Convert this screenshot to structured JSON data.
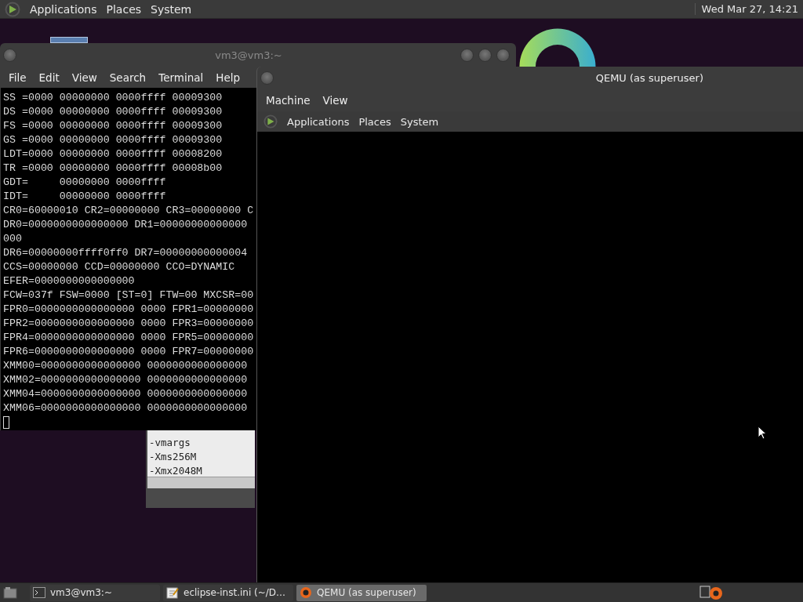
{
  "top_panel": {
    "menus": [
      "Applications",
      "Places",
      "System"
    ],
    "clock": "Wed Mar 27, 14:21"
  },
  "terminal_window": {
    "title": "vm3@vm3:~",
    "menus": [
      "File",
      "Edit",
      "View",
      "Search",
      "Terminal",
      "Help"
    ],
    "lines": [
      "SS =0000 00000000 0000ffff 00009300",
      "DS =0000 00000000 0000ffff 00009300",
      "FS =0000 00000000 0000ffff 00009300",
      "GS =0000 00000000 0000ffff 00009300",
      "LDT=0000 00000000 0000ffff 00008200",
      "TR =0000 00000000 0000ffff 00008b00",
      "GDT=     00000000 0000ffff",
      "IDT=     00000000 0000ffff",
      "CR0=60000010 CR2=00000000 CR3=00000000 C",
      "DR0=0000000000000000 DR1=00000000000000",
      "000",
      "DR6=00000000ffff0ff0 DR7=00000000000004",
      "CCS=00000000 CCD=00000000 CCO=DYNAMIC",
      "EFER=0000000000000000",
      "FCW=037f FSW=0000 [ST=0] FTW=00 MXCSR=00",
      "FPR0=0000000000000000 0000 FPR1=00000000",
      "FPR2=0000000000000000 0000 FPR3=00000000",
      "FPR4=0000000000000000 0000 FPR5=00000000",
      "FPR6=0000000000000000 0000 FPR7=00000000",
      "XMM00=0000000000000000 0000000000000000",
      "XMM02=0000000000000000 0000000000000000",
      "XMM04=0000000000000000 0000000000000000",
      "XMM06=0000000000000000 0000000000000000"
    ]
  },
  "editor_window": {
    "lines": [
      "-vmargs",
      "-Xms256M",
      "-Xmx2048M"
    ]
  },
  "qemu_window": {
    "title": "QEMU (as superuser)",
    "menus": [
      "Machine",
      "View"
    ],
    "guest_panel": {
      "menus": [
        "Applications",
        "Places",
        "System"
      ]
    }
  },
  "taskbar": {
    "tasks": [
      {
        "label": "vm3@vm3:~",
        "kind": "terminal",
        "selected": false
      },
      {
        "label": "eclipse-inst.ini (~/D…",
        "kind": "editor",
        "selected": false
      },
      {
        "label": "QEMU (as superuser)",
        "kind": "qemu",
        "selected": true
      }
    ]
  }
}
